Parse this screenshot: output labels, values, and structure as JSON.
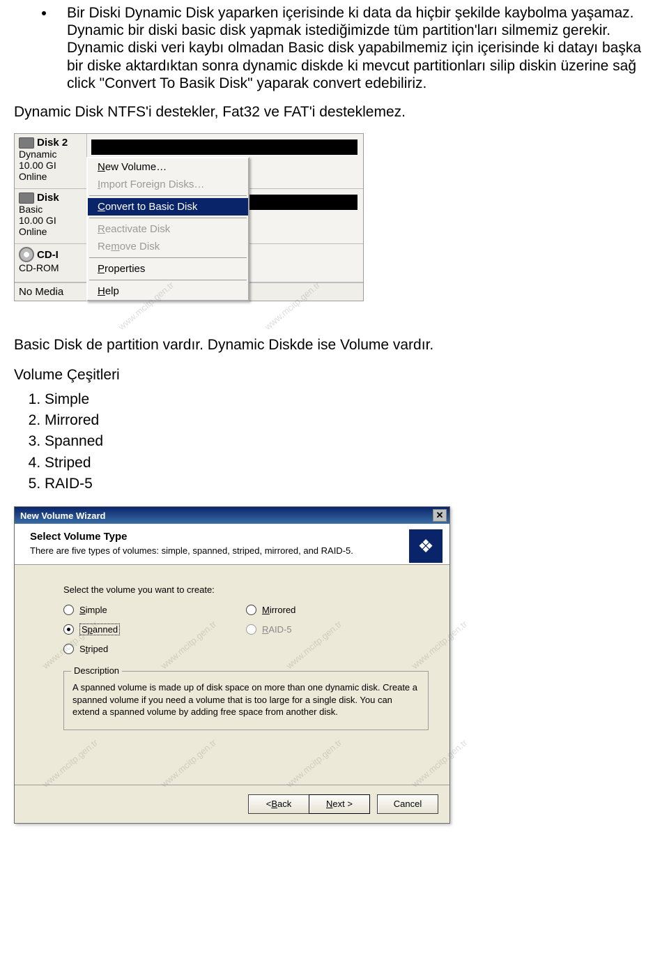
{
  "bullet_text": "Bir Diski Dynamic Disk yaparken içerisinde ki data da hiçbir şekilde kaybolma yaşamaz.  Dynamic bir diski basic disk yapmak istediğimizde tüm partition'ları silmemiz gerekir. Dynamic diski veri kaybı olmadan Basic disk yapabilmemiz için içerisinde ki datayı başka bir diske aktardıktan sonra dynamic diskde ki mevcut partitionları silip diskin üzerine sağ click \"Convert To Basik Disk\" yaparak convert edebiliriz.",
  "para_ntfs": "Dynamic Disk NTFS'i destekler, Fat32 ve FAT'i desteklemez.",
  "dm": {
    "disk2": {
      "title": "Disk 2",
      "type": "Dynamic",
      "size": "10.00 GI",
      "status": "Online"
    },
    "disk": {
      "title": "Disk",
      "type": "Basic",
      "size": "10.00 GI",
      "status": "Online"
    },
    "cd": {
      "title": "CD-I",
      "type": "CD-ROM"
    },
    "nomedia": "No Media",
    "menu": {
      "new_pre": "N",
      "new_rest": "ew Volume…",
      "import_pre": "I",
      "import_rest": "mport Foreign Disks…",
      "convert_pre": "C",
      "convert_rest": "onvert to Basic Disk",
      "react_pre": "R",
      "react_rest": "eactivate Disk",
      "remove_pre": "Re",
      "remove_und": "m",
      "remove_rest": "ove Disk",
      "prop_pre": "P",
      "prop_rest": "roperties",
      "help_pre": "H",
      "help_rest": "elp"
    }
  },
  "para_basic": "Basic Disk de partition vardır. Dynamic Diskde ise Volume vardır.",
  "vol_header": "Volume Çeşitleri",
  "vol_list": {
    "i1": "Simple",
    "i2": "Mirrored",
    "i3": "Spanned",
    "i4": "Striped",
    "i5": "RAID-5"
  },
  "wiz": {
    "title": "New Volume Wizard",
    "head_title": "Select Volume Type",
    "head_sub": "There are five types of volumes: simple, spanned, striped, mirrored, and RAID-5.",
    "select_label": "Select the volume you want to create:",
    "opts": {
      "simple_pre": "S",
      "simple_rest": "imple",
      "spanned_pre": "S",
      "spanned_und": "p",
      "spanned_rest": "anned",
      "striped_pre": "S",
      "striped_und": "t",
      "striped_rest": "riped",
      "mirrored_pre": "M",
      "mirrored_rest": "irrored",
      "raid_pre": "R",
      "raid_rest": "AID-5"
    },
    "group_legend": "Description",
    "group_desc": "A spanned volume is made up of disk space on more than one dynamic disk. Create a spanned volume if you need a volume that is too large for a single disk. You can extend a spanned volume by adding free space from another disk.",
    "btn_back_pre": "< ",
    "btn_back_und": "B",
    "btn_back_rest": "ack",
    "btn_next_pre": "",
    "btn_next_und": "N",
    "btn_next_rest": "ext >",
    "btn_cancel": "Cancel"
  },
  "watermark": "www.mcitp.gen.tr"
}
